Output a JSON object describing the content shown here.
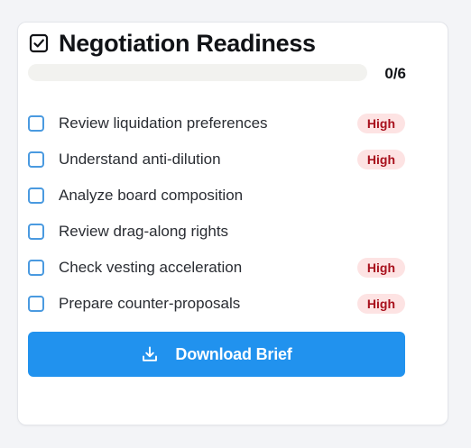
{
  "card": {
    "title": "Negotiation Readiness",
    "title_icon": "checkbox-checked-icon"
  },
  "progress": {
    "completed": 0,
    "total": 6,
    "label": "0/6",
    "fraction": 0
  },
  "checklist": {
    "items": [
      {
        "label": "Review liquidation preferences",
        "checked": false,
        "priority": "High"
      },
      {
        "label": "Understand anti-dilution",
        "checked": false,
        "priority": "High"
      },
      {
        "label": "Analyze board composition",
        "checked": false,
        "priority": ""
      },
      {
        "label": "Review drag-along rights",
        "checked": false,
        "priority": ""
      },
      {
        "label": "Check vesting acceleration",
        "checked": false,
        "priority": "High"
      },
      {
        "label": "Prepare counter-proposals",
        "checked": false,
        "priority": "High"
      }
    ]
  },
  "download_button": {
    "label": "Download Brief",
    "icon": "download-icon"
  },
  "colors": {
    "accent": "#2192ee",
    "badge_bg": "#fde3e3",
    "badge_text": "#a8101c",
    "checkbox_border": "#4a9ae0"
  }
}
